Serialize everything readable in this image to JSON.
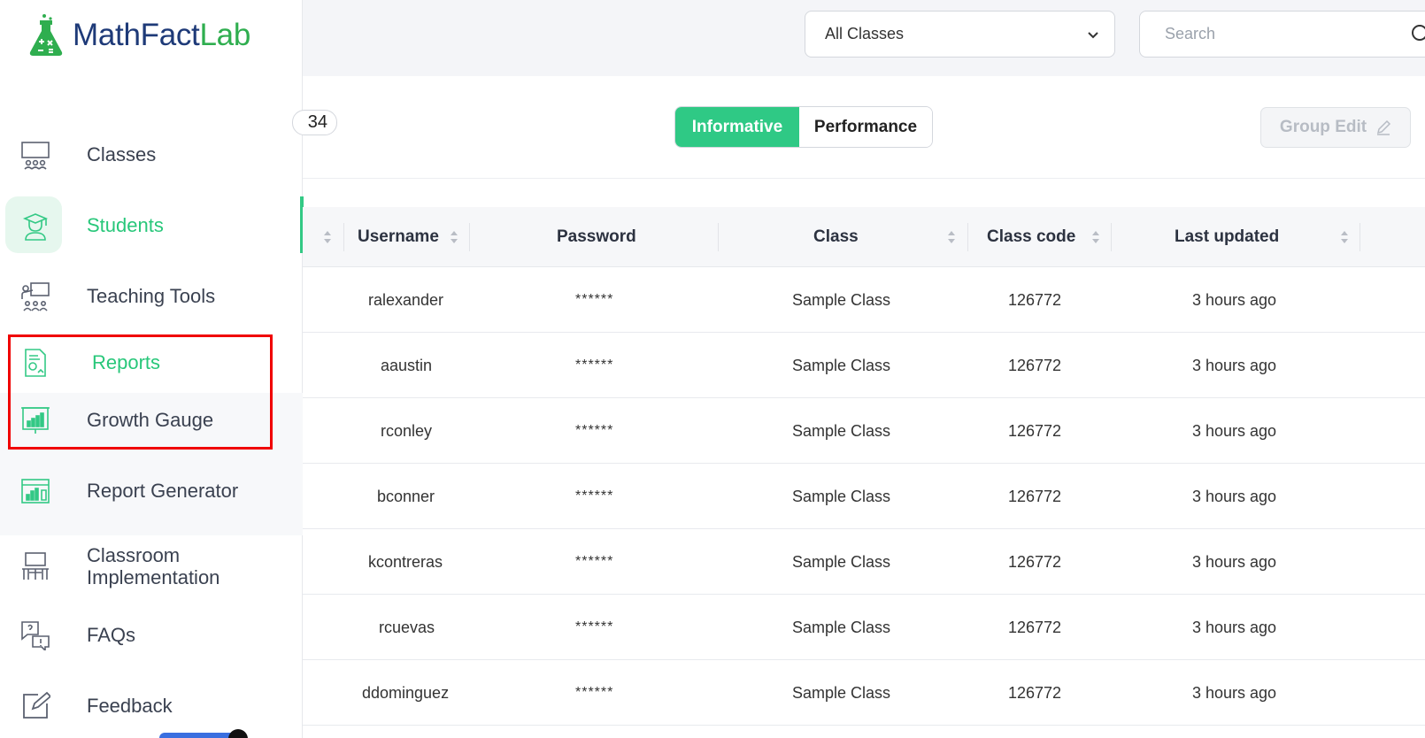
{
  "app": {
    "logo_part1": "MathFact",
    "logo_part2": "Lab"
  },
  "sidebar": {
    "items": [
      {
        "label": "Classes",
        "icon": "classroom-icon"
      },
      {
        "label": "Students",
        "icon": "graduate-student-icon"
      },
      {
        "label": "Teaching Tools",
        "icon": "teaching-tools-icon"
      },
      {
        "label": "Reports",
        "icon": "report-document-icon"
      },
      {
        "label": "Growth Gauge",
        "icon": "bar-chart-board-icon"
      },
      {
        "label": "Report Generator",
        "icon": "report-generator-icon"
      },
      {
        "label": "Classroom Implementation",
        "icon": "classroom-implementation-icon"
      },
      {
        "label": "FAQs",
        "icon": "faq-chat-icon"
      },
      {
        "label": "Feedback",
        "icon": "edit-pencil-icon"
      }
    ],
    "active_item": "Students"
  },
  "topbar": {
    "class_select": {
      "value": "All Classes"
    },
    "search": {
      "placeholder": "Search"
    }
  },
  "toolbar": {
    "count": "34",
    "tabs": [
      {
        "label": "Informative",
        "active": true
      },
      {
        "label": "Performance",
        "active": false
      }
    ],
    "group_edit_label": "Group Edit"
  },
  "table": {
    "columns": [
      "Username",
      "Password",
      "Class",
      "Class code",
      "Last updated"
    ],
    "rows": [
      {
        "username": "ralexander",
        "password": "******",
        "class": "Sample Class",
        "class_code": "126772",
        "last_updated": "3 hours ago"
      },
      {
        "username": "aaustin",
        "password": "******",
        "class": "Sample Class",
        "class_code": "126772",
        "last_updated": "3 hours ago"
      },
      {
        "username": "rconley",
        "password": "******",
        "class": "Sample Class",
        "class_code": "126772",
        "last_updated": "3 hours ago"
      },
      {
        "username": "bconner",
        "password": "******",
        "class": "Sample Class",
        "class_code": "126772",
        "last_updated": "3 hours ago"
      },
      {
        "username": "kcontreras",
        "password": "******",
        "class": "Sample Class",
        "class_code": "126772",
        "last_updated": "3 hours ago"
      },
      {
        "username": "rcuevas",
        "password": "******",
        "class": "Sample Class",
        "class_code": "126772",
        "last_updated": "3 hours ago"
      },
      {
        "username": "ddominguez",
        "password": "******",
        "class": "Sample Class",
        "class_code": "126772",
        "last_updated": "3 hours ago"
      }
    ]
  },
  "colors": {
    "brand_green": "#2fc985",
    "brand_navy": "#1e3a78",
    "highlight_red": "#f00000"
  }
}
